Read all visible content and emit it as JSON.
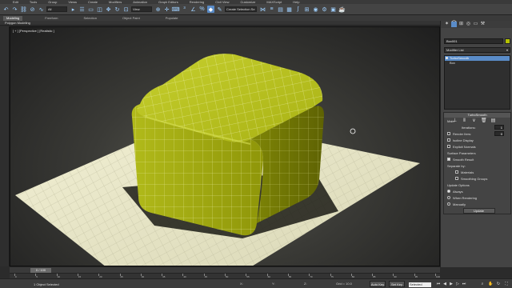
{
  "menu": [
    "Edit",
    "Tools",
    "Group",
    "Views",
    "Create",
    "Modifiers",
    "Animation",
    "Graph Editors",
    "Rendering",
    "Civil View",
    "Customize",
    "MAXScript",
    "Help"
  ],
  "toolbar": {
    "selection_filter": "All",
    "ref_coord": "View",
    "named_selection": "Create Selection Se"
  },
  "ribbon": {
    "tabs": [
      "Modeling",
      "Freeform",
      "Selection",
      "Object Paint",
      "Populate"
    ],
    "active_tab": "Modeling",
    "sub_label": "Polygon Modeling"
  },
  "viewport": {
    "label": "[ + ] [Perspective ] [Realistic ]"
  },
  "command_panel": {
    "object_name": "Box001",
    "object_color": "#b5c200",
    "modifier_list": "Modifier List",
    "stack": [
      {
        "label": "TurboSmooth",
        "selected": true
      },
      {
        "label": "Box",
        "selected": false
      }
    ],
    "turbosmooth": {
      "title": "TurboSmooth",
      "main_label": "Main",
      "iterations_label": "Iterations:",
      "iterations": "1",
      "render_iters_label": "Render Iters:",
      "render_iters": "0",
      "isoline_label": "Isoline Display",
      "explicit_normals_label": "Explicit Normals",
      "surface_params_label": "Surface Parameters",
      "smooth_result_label": "Smooth Result",
      "separate_by_label": "Separate by:",
      "materials_label": "Materials",
      "smoothing_groups_label": "Smoothing Groups",
      "update_options_label": "Update Options",
      "always_label": "Always",
      "when_rendering_label": "When Rendering",
      "manually_label": "Manually",
      "update_button": "Update"
    }
  },
  "timeline": {
    "current": "0 / 100",
    "ticks": [
      "0",
      "5",
      "10",
      "15",
      "20",
      "25",
      "30",
      "35",
      "40",
      "45",
      "50",
      "55",
      "60",
      "65",
      "70",
      "75",
      "80",
      "85",
      "90",
      "95",
      "100"
    ]
  },
  "status": {
    "text": "1 Object Selected",
    "x": "X:",
    "y": "Y:",
    "z": "Z:",
    "grid": "Grid = 10.0",
    "auto_key": "Auto Key",
    "set_key": "Set Key",
    "selected_dropdown": "Selected"
  }
}
